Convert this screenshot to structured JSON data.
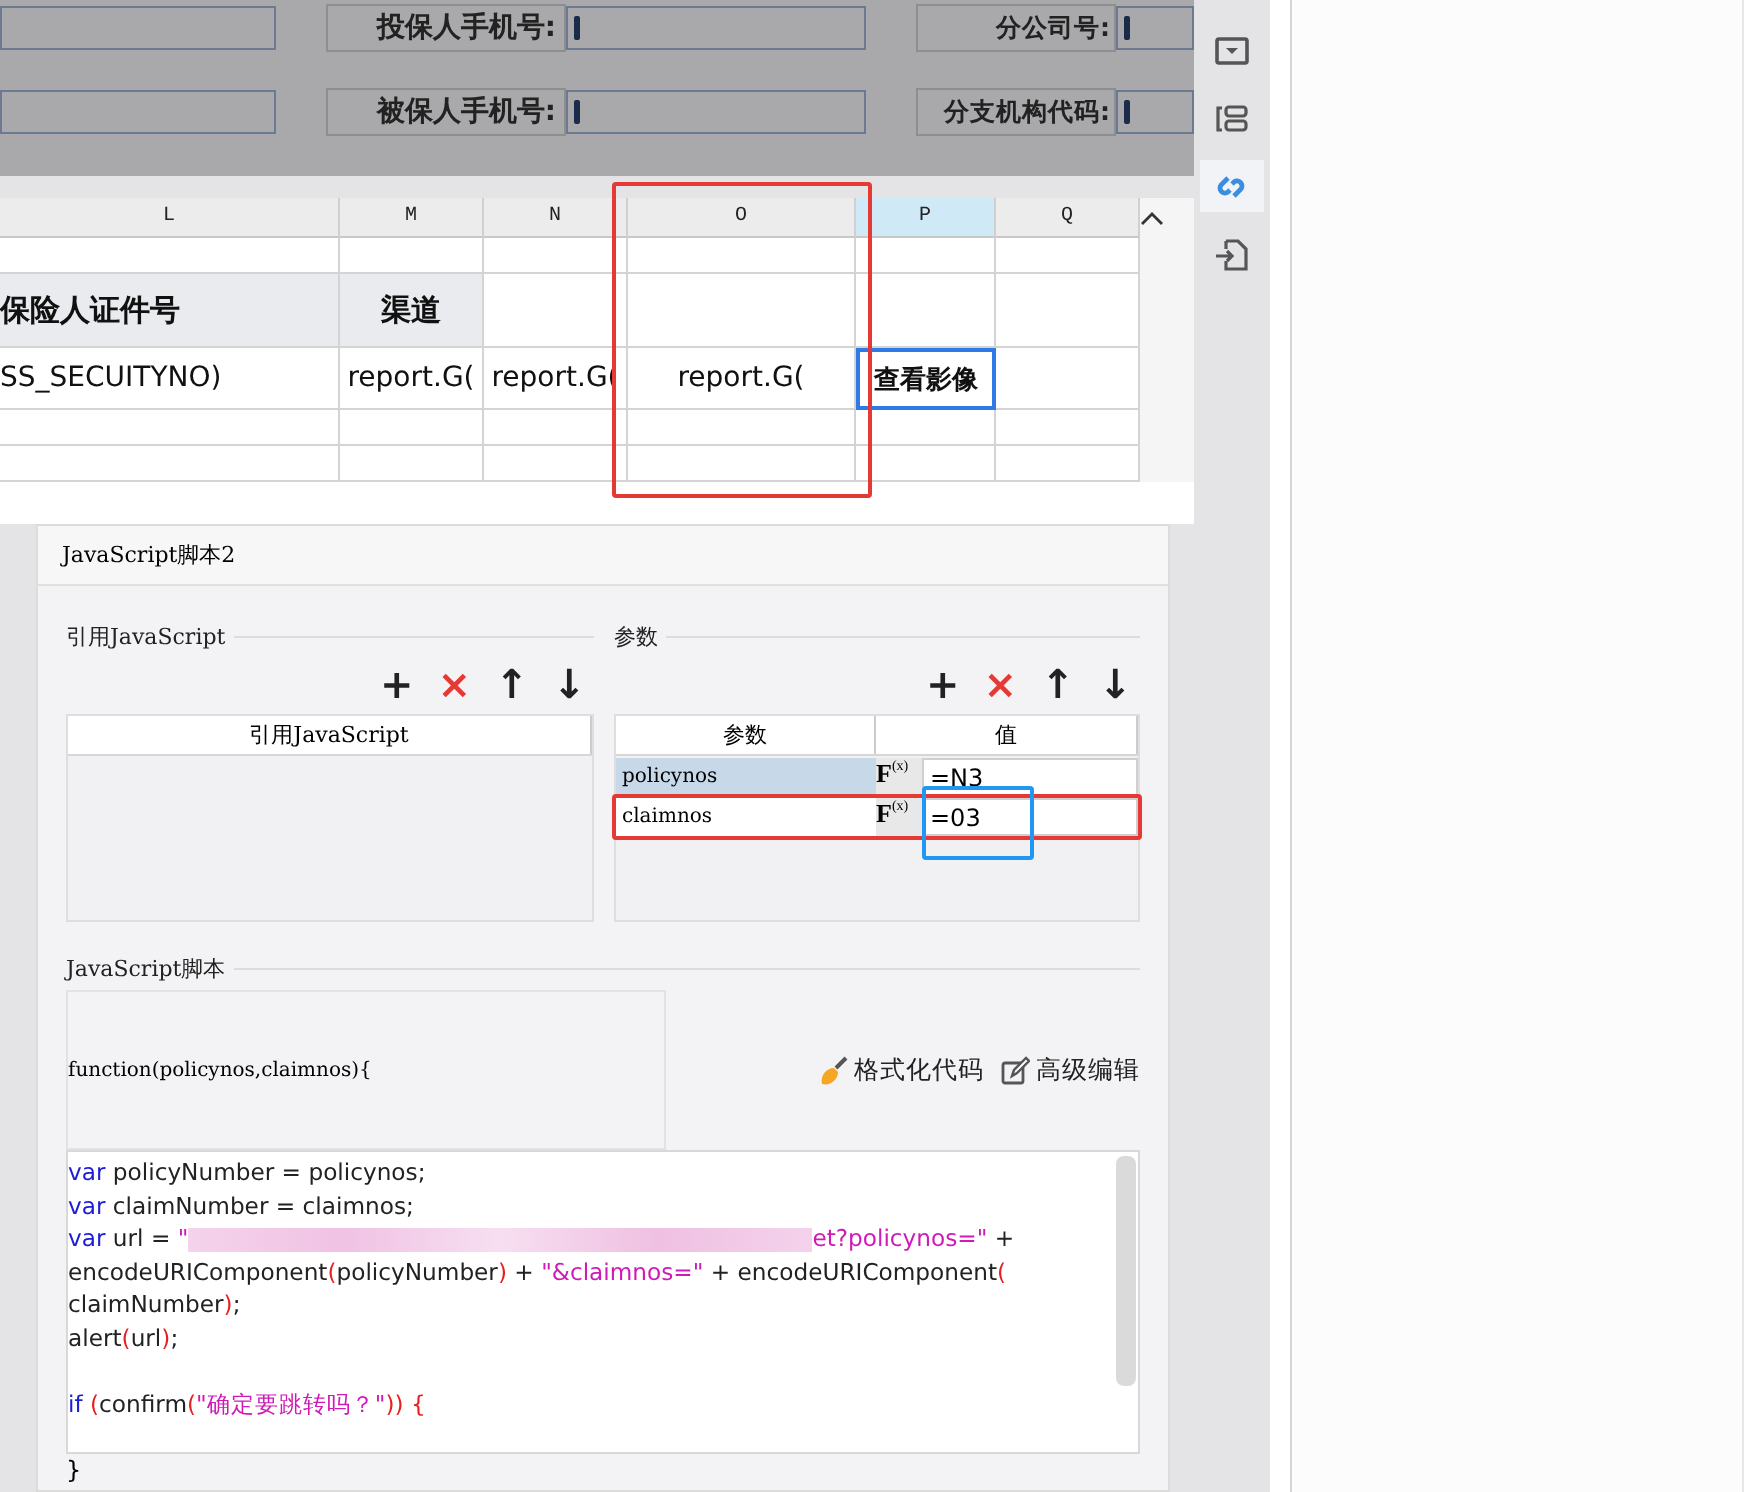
{
  "form": {
    "rows": [
      {
        "fields": [
          {
            "label": "投保人手机号:"
          },
          {
            "label": "分公司号:"
          }
        ]
      },
      {
        "fields": [
          {
            "label": "被保人手机号:"
          },
          {
            "label": "分支机构代码:"
          }
        ]
      }
    ]
  },
  "sheet": {
    "columns": [
      {
        "name": "L",
        "selected": false
      },
      {
        "name": "M",
        "selected": false
      },
      {
        "name": "N",
        "selected": false
      },
      {
        "name": "O",
        "selected": false,
        "color": "#e53935"
      },
      {
        "name": "P",
        "selected": true
      },
      {
        "name": "Q",
        "selected": false
      }
    ],
    "rows": [
      {
        "kind": "blank",
        "cells": [
          {
            "selected": false
          },
          {
            "selected": false
          },
          {
            "selected": false
          },
          {
            "selected": false
          },
          {
            "selected": false
          },
          {
            "selected": false
          }
        ]
      },
      {
        "kind": "heading",
        "cells": [
          {
            "text": "保险人证件号",
            "selected": false
          },
          {
            "text": "渠道",
            "selected": false
          },
          {
            "selected": false
          },
          {
            "selected": false
          },
          {
            "selected": false
          },
          {
            "selected": false
          }
        ]
      },
      {
        "kind": "formula",
        "cells": [
          {
            "text": "SS_SECUITYNO)",
            "selected": false
          },
          {
            "text": "report.G(",
            "selected": false
          },
          {
            "text": "report.G(",
            "selected": false
          },
          {
            "text": "report.G(",
            "selected": false
          },
          {
            "text": "查看影像",
            "selected": true
          },
          {
            "selected": false
          }
        ]
      },
      {
        "kind": "blank",
        "cells": [
          {
            "selected": false
          },
          {
            "selected": false
          },
          {
            "selected": false
          },
          {
            "selected": false
          },
          {
            "selected": false
          },
          {
            "selected": false
          }
        ]
      },
      {
        "kind": "blank",
        "cells": [
          {
            "selected": false
          },
          {
            "selected": false
          },
          {
            "selected": false
          },
          {
            "selected": false
          },
          {
            "selected": false
          },
          {
            "selected": false
          }
        ]
      }
    ]
  },
  "dialog": {
    "title": "JavaScript脚本2",
    "references": {
      "title": "引用JavaScript",
      "tools": [
        {
          "kind": "add",
          "label": "+"
        },
        {
          "kind": "delete",
          "label": "×"
        },
        {
          "kind": "up",
          "label": "↑"
        },
        {
          "kind": "down",
          "label": "↓"
        }
      ],
      "column": "引用JavaScript"
    },
    "parameters": {
      "title": "参数",
      "tools": [
        {
          "kind": "add",
          "label": "+"
        },
        {
          "kind": "delete",
          "label": "×"
        },
        {
          "kind": "up",
          "label": "↑"
        },
        {
          "kind": "down",
          "label": "↓"
        }
      ],
      "columns": [
        "参数",
        "值"
      ],
      "rows": [
        {
          "name": "policynos",
          "formula_button": "F",
          "formula_sub": "(x)",
          "value": "=N3",
          "selected": true
        },
        {
          "name": "claimnos",
          "formula_button": "F",
          "formula_sub": "(x)",
          "value": "=03",
          "selected": false,
          "color": "#e53935",
          "value_highlight": {
            "color": "#2196f3"
          }
        }
      ]
    },
    "script": {
      "title": "JavaScript脚本",
      "signature": "function(policynos,claimnos){",
      "actions": [
        {
          "kind": "format",
          "label": "格式化代码"
        },
        {
          "kind": "edit",
          "label": "高级编辑"
        }
      ],
      "lines": [
        [
          {
            "kind": "kw",
            "text": "var"
          },
          {
            "kind": "plain",
            "text": " policyNumber = policynos;"
          }
        ],
        [
          {
            "kind": "kw",
            "text": "var"
          },
          {
            "kind": "plain",
            "text": " claimNumber = claimnos;"
          }
        ],
        [
          {
            "kind": "kw",
            "text": "var"
          },
          {
            "kind": "plain",
            "text": " url = "
          },
          {
            "kind": "str",
            "text": "\""
          },
          {
            "kind": "blur"
          },
          {
            "kind": "str",
            "text": "et?policynos=\""
          },
          {
            "kind": "plain",
            "text": " +"
          }
        ],
        [
          {
            "kind": "plain",
            "text": "encodeURIComponent"
          },
          {
            "kind": "punc",
            "text": "("
          },
          {
            "kind": "plain",
            "text": "policyNumber"
          },
          {
            "kind": "punc",
            "text": ")"
          },
          {
            "kind": "plain",
            "text": " + "
          },
          {
            "kind": "str",
            "text": "\"&claimnos=\""
          },
          {
            "kind": "plain",
            "text": " + encodeURIComponent"
          },
          {
            "kind": "punc",
            "text": "("
          }
        ],
        [
          {
            "kind": "plain",
            "text": "claimNumber"
          },
          {
            "kind": "punc",
            "text": ")"
          },
          {
            "kind": "plain",
            "text": ";"
          }
        ],
        [
          {
            "kind": "plain",
            "text": "alert"
          },
          {
            "kind": "punc",
            "text": "("
          },
          {
            "kind": "plain",
            "text": "url"
          },
          {
            "kind": "punc",
            "text": ")"
          },
          {
            "kind": "plain",
            "text": ";"
          }
        ],
        {
          "blank_before": true,
          "tokens": [
            {
              "kind": "kw",
              "text": "if"
            },
            {
              "kind": "punc",
              "text": " ("
            },
            {
              "kind": "plain",
              "text": "confirm"
            },
            {
              "kind": "punc",
              "text": "("
            },
            {
              "kind": "str",
              "text": "\"确定要跳转吗？\""
            },
            {
              "kind": "punc",
              "text": ")) {"
            }
          ]
        }
      ],
      "closing": "}"
    }
  },
  "toolbar": {
    "items": [
      {
        "kind": "dropdown",
        "selected": false
      },
      {
        "kind": "layout",
        "selected": false
      },
      {
        "kind": "link",
        "selected": true
      },
      {
        "kind": "import",
        "selected": false
      }
    ]
  }
}
